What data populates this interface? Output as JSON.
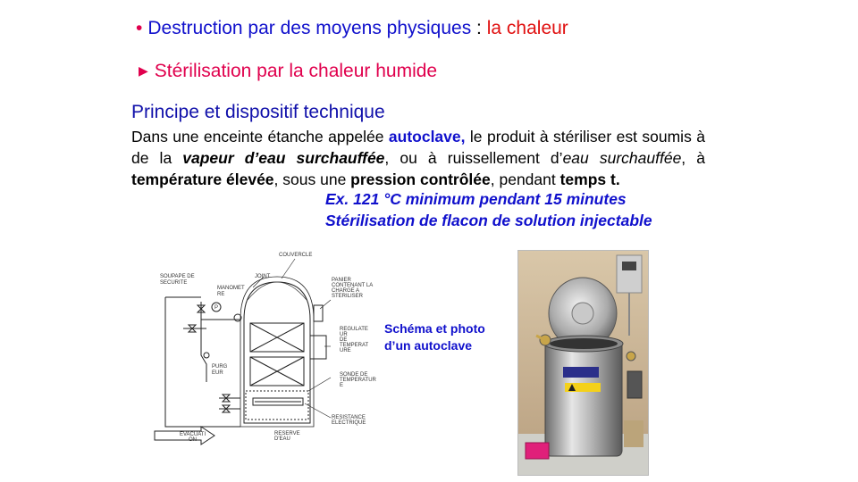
{
  "title_line": {
    "bullet": "•",
    "part1": "Destruction par des moyens physiques",
    "separator": " : ",
    "part2": "la chaleur"
  },
  "subtitle_line": {
    "bullet": "▶",
    "text": "Stérilisation par la chaleur humide"
  },
  "section_heading": "Principe et dispositif technique",
  "paragraph": {
    "t1": "Dans une enceinte étanche appelée ",
    "autoclave": "autoclave,",
    "t2": " le produit à stériliser est soumis à de la ",
    "vapeur": "vapeur d’eau surchauffée",
    "t3": ", ou à ruissellement d’",
    "eau": "eau surchauffée",
    "t4": ", à ",
    "temperature": "température élevée",
    "t5": ", sous une ",
    "pression": "pression contrôlée",
    "t6": ", pendant ",
    "temps": "temps t."
  },
  "example_line1": "Ex. 121 °C minimum pendant 15 minutes",
  "example_line2": "Stérilisation de flacon de solution injectable",
  "caption": {
    "line1": "Schéma et photo",
    "line2": "d’un autoclave"
  },
  "diagram_labels": {
    "couvercle": "COUVERCLE",
    "soupape1": "SOUPAPE DE",
    "soupape2": "SECURITE",
    "joint": "JOINT",
    "manometre1": "MANOMET",
    "manometre2": "RE",
    "panier1": "PANIER",
    "panier2": "CONTENANT LA",
    "panier3": "CHARGE A",
    "panier4": "STERILISER",
    "regulateur1": "REGULATE",
    "regulateur2": "UR",
    "regulateur3": "DE",
    "regulateur4": "TEMPERAT",
    "regulateur5": "URE",
    "purgeur1": "PURG",
    "purgeur2": "EUR",
    "sonde1": "SONDE DE",
    "sonde2": "TEMPERATUR",
    "sonde3": "E",
    "resistance1": "RESISTANCE",
    "resistance2": "ELECTRIQUE",
    "reserve1": "RESERVE",
    "reserve2": "D'EAU",
    "evacuation1": "EVACUATI",
    "evacuation2": "ON",
    "manometer_symbol": "P"
  },
  "colors": {
    "blue": "#1010cc",
    "red": "#e01010",
    "magenta": "#e0004d"
  }
}
